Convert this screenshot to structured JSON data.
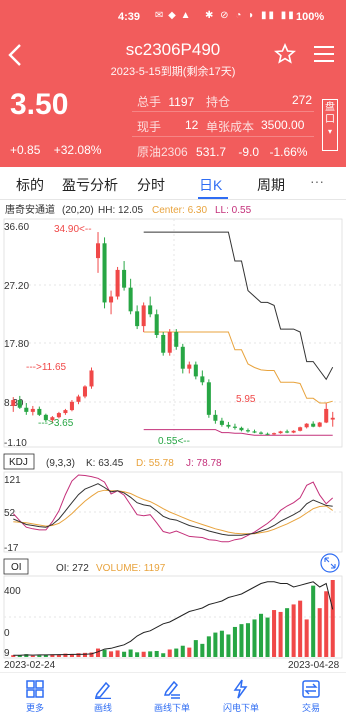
{
  "status_bar": {
    "time": "4:39",
    "battery": "100%"
  },
  "header": {
    "title": "sc2306P490",
    "subtitle": "2023-5-15到期(剩余17天)",
    "price": "3.50",
    "change": "+0.85",
    "change_pct": "+32.08%",
    "plate_label": "盘口"
  },
  "info": {
    "total_label": "总手",
    "total_value": "1197",
    "oi_label": "持仓",
    "oi_value": "272",
    "now_label": "现手",
    "now_value": "12",
    "cost_label": "单张成本",
    "cost_value": "3500.00",
    "underlying_label": "原油2306",
    "underlying_price": "531.7",
    "underlying_change": "-9.0",
    "underlying_change_pct": "-1.66%"
  },
  "tabs": [
    {
      "label": "标的"
    },
    {
      "label": "盈亏分析"
    },
    {
      "label": "分时"
    },
    {
      "label": "日K"
    },
    {
      "label": "周期"
    },
    {
      "label": "···"
    }
  ],
  "main_chart": {
    "indicator": "唐奇安通道",
    "params": "(20,20)",
    "hh_label": "HH: 12.05",
    "center_label": "Center: 6.30",
    "ll_label": "LL: 0.55",
    "axis_labels": [
      "36.60",
      "27.20",
      "17.80",
      "8.30",
      "-1.10"
    ],
    "annotations": {
      "high": "34.90<--",
      "a1": "--->11.65",
      "a2": "--->3.65",
      "low": "0.55<--",
      "last": "5.95"
    }
  },
  "kdj": {
    "title": "KDJ",
    "params": "(9,3,3)",
    "k_label": "K: 63.45",
    "d_label": "D: 55.78",
    "j_label": "J: 78.78",
    "axis_labels": [
      "121",
      "52",
      "-17"
    ]
  },
  "oi_panel": {
    "title": "OI",
    "oi_label": "OI: 272",
    "volume_label": "VOLUME: 1197",
    "axis_labels": [
      "400",
      "0",
      "9"
    ]
  },
  "dates": {
    "start": "2023-02-24",
    "end": "2023-04-28"
  },
  "bottom_nav": [
    {
      "label": "更多",
      "icon": "grid-icon"
    },
    {
      "label": "画线",
      "icon": "pen-icon"
    },
    {
      "label": "画线下单",
      "icon": "pen-order-icon"
    },
    {
      "label": "闪电下单",
      "icon": "lightning-icon"
    },
    {
      "label": "交易",
      "icon": "trade-icon"
    }
  ],
  "colors": {
    "header": "#f25c5c",
    "up": "#f04848",
    "down": "#27a644",
    "accent": "#2f6df3",
    "center": "#e8a33d",
    "ll": "#c4307a"
  },
  "chart_data": {
    "type": "candlestick",
    "x": [
      "2023-02-24",
      "2023-04-28"
    ],
    "ohlc": [
      [
        5.5,
        7.0,
        4.5,
        6.5
      ],
      [
        6.5,
        7.2,
        5.0,
        5.2
      ],
      [
        5.2,
        6.0,
        4.0,
        4.5
      ],
      [
        4.5,
        5.5,
        3.9,
        5.0
      ],
      [
        5.0,
        5.4,
        3.8,
        4.0
      ],
      [
        4.0,
        4.2,
        2.8,
        3.1
      ],
      [
        3.1,
        3.8,
        2.6,
        3.6
      ],
      [
        3.6,
        4.5,
        3.4,
        4.3
      ],
      [
        4.3,
        5.0,
        4.0,
        4.8
      ],
      [
        4.8,
        6.5,
        4.6,
        6.2
      ],
      [
        6.2,
        7.4,
        5.8,
        7.1
      ],
      [
        7.1,
        9.0,
        6.8,
        8.8
      ],
      [
        8.8,
        12.0,
        8.4,
        11.5
      ],
      [
        30.5,
        34.9,
        28.0,
        33.0
      ],
      [
        33.0,
        34.0,
        22.0,
        23.0
      ],
      [
        23.0,
        25.0,
        21.0,
        24.0
      ],
      [
        24.0,
        29.0,
        23.5,
        28.5
      ],
      [
        28.5,
        30.0,
        25.0,
        25.5
      ],
      [
        25.5,
        27.0,
        21.0,
        21.5
      ],
      [
        21.5,
        22.5,
        18.5,
        19.0
      ],
      [
        19.0,
        23.0,
        18.0,
        22.5
      ],
      [
        22.5,
        24.0,
        20.5,
        21.0
      ],
      [
        21.0,
        21.8,
        17.0,
        17.5
      ],
      [
        17.5,
        18.0,
        14.0,
        14.5
      ],
      [
        14.5,
        18.5,
        14.0,
        18.0
      ],
      [
        18.0,
        18.5,
        15.0,
        15.5
      ],
      [
        15.5,
        16.0,
        11.0,
        11.8
      ],
      [
        11.8,
        13.0,
        11.0,
        12.5
      ],
      [
        12.5,
        13.0,
        10.0,
        10.5
      ],
      [
        10.5,
        11.5,
        9.0,
        9.5
      ],
      [
        9.5,
        10.0,
        3.5,
        4.0
      ],
      [
        4.0,
        4.8,
        2.5,
        3.0
      ],
      [
        3.0,
        3.5,
        2.0,
        2.3
      ],
      [
        2.3,
        2.8,
        1.7,
        2.0
      ],
      [
        2.0,
        2.5,
        1.5,
        1.8
      ],
      [
        1.8,
        2.0,
        1.2,
        1.4
      ],
      [
        1.4,
        1.7,
        1.0,
        1.2
      ],
      [
        1.2,
        1.5,
        0.9,
        1.0
      ],
      [
        1.0,
        1.2,
        0.7,
        0.8
      ],
      [
        0.8,
        1.0,
        0.55,
        0.7
      ],
      [
        0.7,
        1.0,
        0.6,
        0.9
      ],
      [
        0.9,
        1.3,
        0.8,
        1.2
      ],
      [
        1.2,
        1.5,
        0.9,
        1.0
      ],
      [
        1.0,
        1.4,
        0.9,
        1.3
      ],
      [
        1.3,
        2.0,
        1.2,
        1.9
      ],
      [
        1.9,
        2.6,
        1.7,
        2.5
      ],
      [
        2.5,
        2.9,
        1.9,
        2.0
      ],
      [
        2.0,
        2.8,
        1.9,
        2.7
      ],
      [
        2.7,
        5.95,
        2.6,
        5.0
      ],
      [
        3.2,
        4.5,
        2.0,
        3.5
      ]
    ],
    "hh": [
      null,
      null,
      null,
      null,
      null,
      null,
      null,
      null,
      null,
      null,
      null,
      null,
      null,
      null,
      null,
      null,
      null,
      null,
      null,
      null,
      34.9,
      34.9,
      34.9,
      34.9,
      34.9,
      34.9,
      34.9,
      34.9,
      34.9,
      34.9,
      34.9,
      34.9,
      34.9,
      34.9,
      30.0,
      30.0,
      25.0,
      24.0,
      23.0,
      23.0,
      22.5,
      18.5,
      18.5,
      18.5,
      18.0,
      13.0,
      13.0,
      11.5,
      10.0,
      12.05
    ],
    "center": [
      null,
      null,
      null,
      null,
      null,
      null,
      null,
      null,
      null,
      null,
      null,
      null,
      null,
      null,
      null,
      null,
      null,
      null,
      null,
      null,
      18.0,
      18.0,
      18.0,
      18.0,
      18.0,
      18.0,
      18.0,
      18.0,
      18.0,
      18.0,
      18.0,
      18.0,
      18.0,
      18.0,
      15.0,
      15.0,
      12.6,
      12.0,
      11.6,
      11.5,
      11.5,
      9.5,
      9.5,
      9.5,
      9.3,
      6.8,
      6.8,
      6.0,
      6.0,
      6.3
    ],
    "ll": [
      null,
      null,
      null,
      null,
      null,
      null,
      null,
      null,
      null,
      null,
      null,
      null,
      null,
      null,
      null,
      null,
      null,
      null,
      null,
      null,
      1.5,
      1.5,
      1.5,
      1.5,
      1.5,
      1.5,
      1.5,
      1.5,
      1.5,
      1.5,
      1.5,
      1.5,
      1.0,
      1.0,
      0.9,
      0.9,
      0.7,
      0.55,
      0.55,
      0.55,
      0.55,
      0.55,
      0.55,
      0.55,
      0.55,
      0.55,
      0.55,
      0.55,
      0.55,
      0.55
    ],
    "ylim": [
      -1.1,
      36.6
    ],
    "kdj_series": {
      "k": [
        40,
        35,
        30,
        28,
        26,
        25,
        30,
        40,
        55,
        70,
        85,
        95,
        100,
        105,
        98,
        90,
        92,
        88,
        80,
        70,
        66,
        64,
        55,
        45,
        40,
        38,
        33,
        28,
        25,
        22,
        18,
        15,
        12,
        10,
        10,
        10,
        12,
        14,
        18,
        22,
        28,
        36,
        42,
        48,
        55,
        68,
        75,
        70,
        65,
        63.45
      ],
      "d": [
        35,
        34,
        33,
        31,
        29,
        27,
        28,
        32,
        40,
        50,
        62,
        73,
        82,
        90,
        93,
        92,
        92,
        90,
        87,
        81,
        76,
        72,
        66,
        59,
        53,
        48,
        43,
        38,
        34,
        30,
        26,
        22,
        19,
        16,
        14,
        13,
        13,
        13,
        15,
        17,
        21,
        26,
        31,
        37,
        43,
        51,
        59,
        63,
        64,
        55.78
      ],
      "j": [
        50,
        37,
        25,
        22,
        20,
        20,
        35,
        55,
        85,
        110,
        121,
        120,
        118,
        115,
        108,
        86,
        92,
        84,
        66,
        48,
        46,
        48,
        33,
        17,
        14,
        18,
        13,
        8,
        7,
        6,
        2,
        1,
        -2,
        -2,
        2,
        4,
        10,
        16,
        24,
        32,
        42,
        56,
        64,
        70,
        79,
        102,
        108,
        84,
        68,
        78.78
      ]
    },
    "oi_line": [
      10,
      10,
      12,
      11,
      12,
      12,
      13,
      14,
      14,
      15,
      15,
      16,
      18,
      30,
      45,
      50,
      60,
      70,
      90,
      120,
      140,
      150,
      170,
      190,
      200,
      220,
      240,
      260,
      270,
      280,
      300,
      310,
      320,
      340,
      350,
      360,
      380,
      400,
      420,
      430,
      430,
      420,
      420,
      400,
      410,
      420,
      430,
      400,
      420,
      272
    ],
    "volume": [
      10,
      8,
      15,
      7,
      9,
      12,
      14,
      11,
      18,
      16,
      20,
      22,
      24,
      45,
      38,
      30,
      35,
      28,
      40,
      25,
      28,
      30,
      32,
      20,
      40,
      45,
      60,
      50,
      90,
      70,
      110,
      130,
      140,
      120,
      160,
      175,
      180,
      200,
      230,
      210,
      250,
      240,
      260,
      280,
      300,
      200,
      380,
      260,
      350,
      410
    ]
  }
}
